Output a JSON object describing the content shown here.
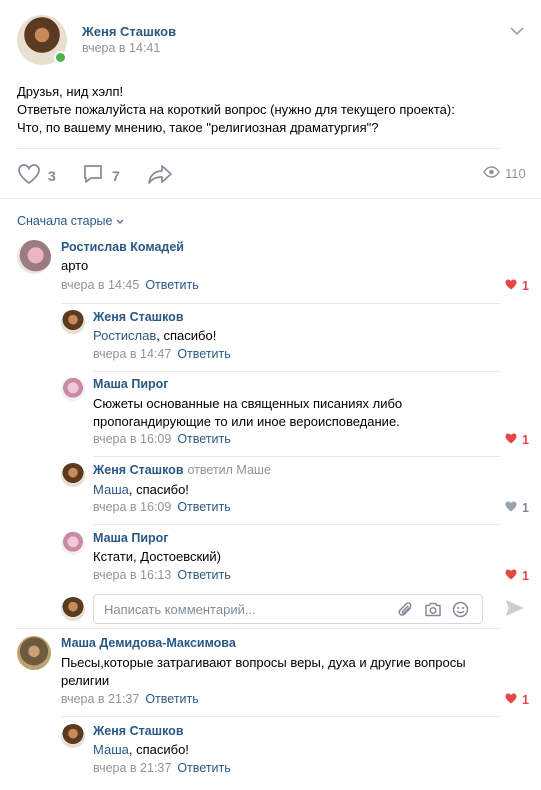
{
  "post": {
    "author": "Женя Сташков",
    "time": "вчера в 14:41",
    "lines": [
      "Друзья, нид хэлп!",
      "Ответьте пожалуйста на короткий вопрос (нужно для текущего проекта):",
      "Что, по вашему мнению, такое \"религиозная драматургия\"?"
    ],
    "likes": "3",
    "comments": "7",
    "views": "110"
  },
  "sort_label": "Сначала старые",
  "reply_label": "Ответить",
  "comment_placeholder": "Написать комментарий...",
  "comments": [
    {
      "name": "Ростислав Комадей",
      "text": "арто",
      "time": "вчера в 14:45",
      "likes": "1",
      "liked": true
    },
    {
      "name": "Женя Сташков",
      "mention": "Ростислав",
      "text": ", спасибо!",
      "time": "вчера в 14:47"
    },
    {
      "name": "Маша Пирог",
      "lines": [
        "Сюжеты основанные на священных писаниях либо",
        "пропогандирующие то или иное вероисповедание."
      ],
      "time": "вчера в 16:09",
      "likes": "1",
      "liked": true
    },
    {
      "name": "Женя Сташков",
      "replied": "ответил Маше",
      "mention": "Маша",
      "text": ", спасибо!",
      "time": "вчера в 16:09",
      "likes": "1",
      "liked": false
    },
    {
      "name": "Маша Пирог",
      "text": "Кстати, Достоевский)",
      "time": "вчера в 16:13",
      "likes": "1",
      "liked": true
    },
    {
      "name": "Маша Демидова-Максимова",
      "lines": [
        "Пьесы,которые затрагивают вопросы веры, духа и другие вопросы",
        "религии"
      ],
      "time": "вчера в 21:37",
      "likes": "1",
      "liked": true
    },
    {
      "name": "Женя Сташков",
      "mention": "Маша",
      "text": ", спасибо!",
      "time": "вчера в 21:37"
    }
  ],
  "colors": {
    "link": "#2a5885",
    "meta": "#939393",
    "like_red": "#e64646",
    "icon_gray": "#828a99"
  }
}
